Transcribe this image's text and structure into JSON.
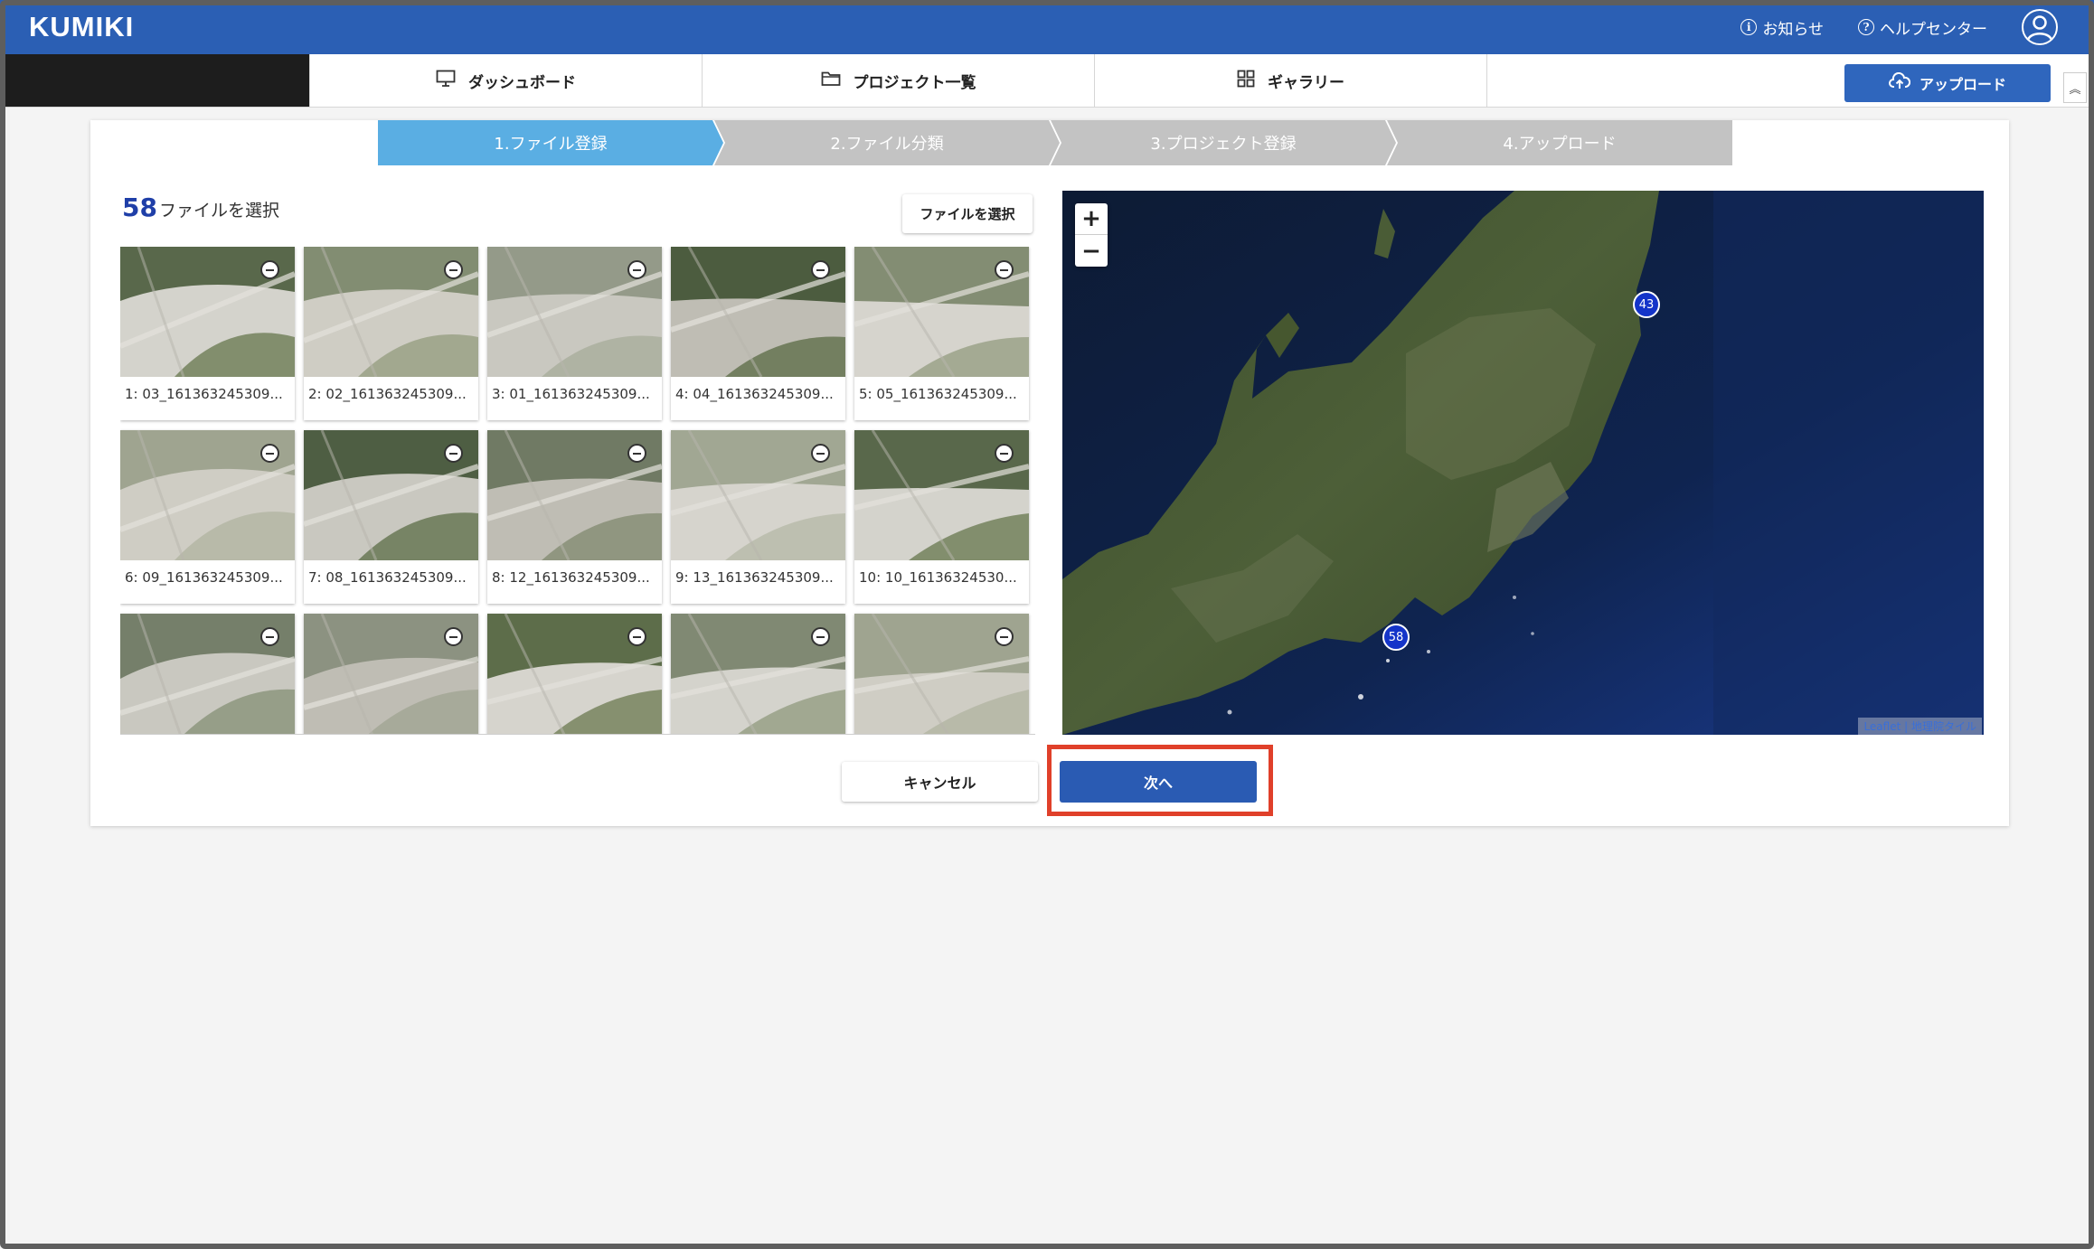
{
  "app": {
    "brand": "KUMIKI",
    "links": {
      "news": "お知らせ",
      "help": "ヘルプセンター"
    },
    "accent_color": "#2b5fb4"
  },
  "nav": {
    "tabs": [
      {
        "label": "ダッシュボード",
        "icon": "monitor-icon"
      },
      {
        "label": "プロジェクト一覧",
        "icon": "folder-icon"
      },
      {
        "label": "ギャラリー",
        "icon": "grid-icon"
      }
    ],
    "upload_label": "アップロード"
  },
  "steps": [
    {
      "label": "1.ファイル登録",
      "active": true
    },
    {
      "label": "2.ファイル分類",
      "active": false
    },
    {
      "label": "3.プロジェクト登録",
      "active": false
    },
    {
      "label": "4.アップロード",
      "active": false
    }
  ],
  "files": {
    "count": "58",
    "count_suffix": "ファイルを選択",
    "choose_label": "ファイルを選択",
    "items": [
      "1: 03_161363245309...",
      "2: 02_161363245309...",
      "3: 01_161363245309...",
      "4: 04_161363245309...",
      "5: 05_161363245309...",
      "6: 09_161363245309...",
      "7: 08_161363245309...",
      "8: 12_161363245309...",
      "9: 13_161363245309...",
      "10: 10_16136324530...",
      "",
      "",
      "",
      "",
      ""
    ]
  },
  "map": {
    "zoom_in": "+",
    "zoom_out": "−",
    "markers": [
      "43",
      "58"
    ],
    "attribution": {
      "leaflet": "Leaflet",
      "separator": " | ",
      "tiles": "地理院タイル"
    }
  },
  "actions": {
    "cancel": "キャンセル",
    "next": "次へ"
  }
}
